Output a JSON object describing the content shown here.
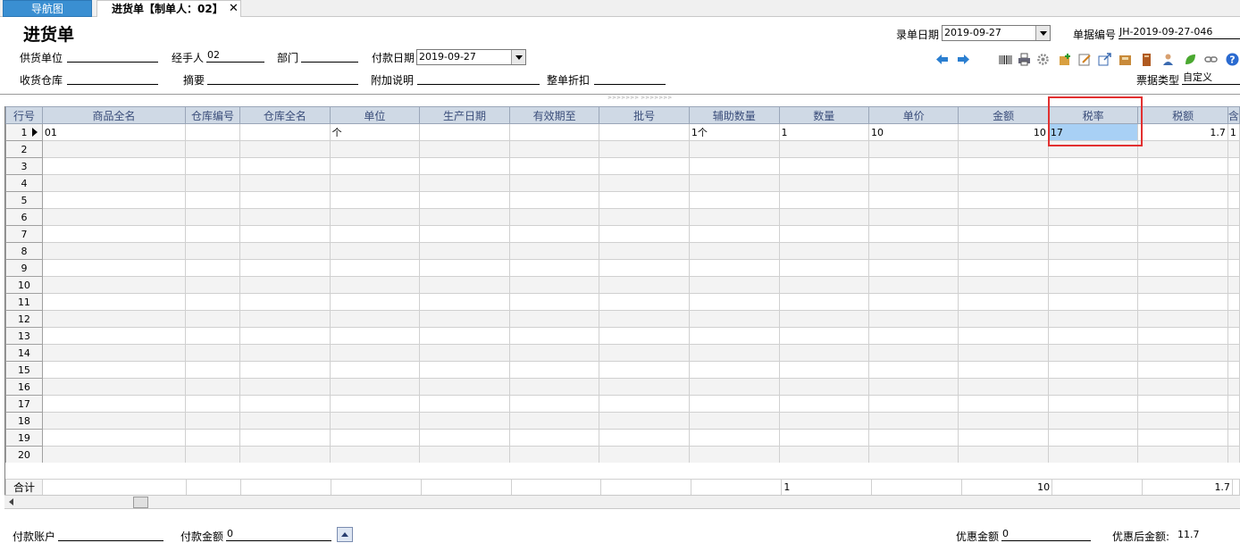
{
  "tabs": {
    "nav": "导航图",
    "purchase": "进货单【制单人：02】",
    "close": "✕"
  },
  "form": {
    "title": "进货单",
    "supplier_label": "供货单位",
    "supplier_value": "",
    "handler_label": "经手人",
    "handler_value": "02",
    "dept_label": "部门",
    "dept_value": "",
    "paydate_label": "付款日期",
    "paydate_value": "2019-09-27",
    "warehouse_label": "收货仓库",
    "warehouse_value": "",
    "summary_label": "摘要",
    "summary_value": "",
    "note_label": "附加说明",
    "note_value": "",
    "discount_label": "整单折扣",
    "discount_value": "",
    "entrydate_label": "录单日期",
    "entrydate_value": "2019-09-27",
    "docno_label": "单据编号",
    "docno_value": "JH-2019-09-27-046",
    "doctype_label": "票据类型",
    "doctype_value": "自定义"
  },
  "toolbar_icons": [
    "arrow-left-icon",
    "arrow-right-icon",
    "barcode-icon",
    "printer-icon",
    "gear-icon",
    "add-item-icon",
    "edit-icon",
    "export-icon",
    "folder-icon",
    "book-icon",
    "user-icon",
    "leaf-icon",
    "link-icon",
    "help-icon"
  ],
  "grid": {
    "headers": [
      "行号",
      "商品全名",
      "仓库编号",
      "仓库全名",
      "单位",
      "生产日期",
      "有效期至",
      "批号",
      "辅助数量",
      "数量",
      "单价",
      "金额",
      "税率",
      "税额",
      "含"
    ],
    "rows": [
      [
        "1",
        "01",
        "",
        "",
        "个",
        "",
        "",
        "",
        "1个",
        "1",
        "10",
        "10",
        "17",
        "1.7",
        "1"
      ],
      [
        "2",
        "",
        "",
        "",
        "",
        "",
        "",
        "",
        "",
        "",
        "",
        "",
        "",
        "",
        ""
      ],
      [
        "3",
        "",
        "",
        "",
        "",
        "",
        "",
        "",
        "",
        "",
        "",
        "",
        "",
        "",
        ""
      ],
      [
        "4",
        "",
        "",
        "",
        "",
        "",
        "",
        "",
        "",
        "",
        "",
        "",
        "",
        "",
        ""
      ],
      [
        "5",
        "",
        "",
        "",
        "",
        "",
        "",
        "",
        "",
        "",
        "",
        "",
        "",
        "",
        ""
      ],
      [
        "6",
        "",
        "",
        "",
        "",
        "",
        "",
        "",
        "",
        "",
        "",
        "",
        "",
        "",
        ""
      ],
      [
        "7",
        "",
        "",
        "",
        "",
        "",
        "",
        "",
        "",
        "",
        "",
        "",
        "",
        "",
        ""
      ],
      [
        "8",
        "",
        "",
        "",
        "",
        "",
        "",
        "",
        "",
        "",
        "",
        "",
        "",
        "",
        ""
      ],
      [
        "9",
        "",
        "",
        "",
        "",
        "",
        "",
        "",
        "",
        "",
        "",
        "",
        "",
        "",
        ""
      ],
      [
        "10",
        "",
        "",
        "",
        "",
        "",
        "",
        "",
        "",
        "",
        "",
        "",
        "",
        "",
        ""
      ],
      [
        "11",
        "",
        "",
        "",
        "",
        "",
        "",
        "",
        "",
        "",
        "",
        "",
        "",
        "",
        ""
      ],
      [
        "12",
        "",
        "",
        "",
        "",
        "",
        "",
        "",
        "",
        "",
        "",
        "",
        "",
        "",
        ""
      ],
      [
        "13",
        "",
        "",
        "",
        "",
        "",
        "",
        "",
        "",
        "",
        "",
        "",
        "",
        "",
        ""
      ],
      [
        "14",
        "",
        "",
        "",
        "",
        "",
        "",
        "",
        "",
        "",
        "",
        "",
        "",
        "",
        ""
      ],
      [
        "15",
        "",
        "",
        "",
        "",
        "",
        "",
        "",
        "",
        "",
        "",
        "",
        "",
        "",
        ""
      ],
      [
        "16",
        "",
        "",
        "",
        "",
        "",
        "",
        "",
        "",
        "",
        "",
        "",
        "",
        "",
        ""
      ],
      [
        "17",
        "",
        "",
        "",
        "",
        "",
        "",
        "",
        "",
        "",
        "",
        "",
        "",
        "",
        ""
      ],
      [
        "18",
        "",
        "",
        "",
        "",
        "",
        "",
        "",
        "",
        "",
        "",
        "",
        "",
        "",
        ""
      ],
      [
        "19",
        "",
        "",
        "",
        "",
        "",
        "",
        "",
        "",
        "",
        "",
        "",
        "",
        "",
        ""
      ],
      [
        "20",
        "",
        "",
        "",
        "",
        "",
        "",
        "",
        "",
        "",
        "",
        "",
        "",
        "",
        ""
      ]
    ],
    "sum": [
      "合计",
      "",
      "",
      "",
      "",
      "",
      "",
      "",
      "",
      "1",
      "",
      "10",
      "",
      "1.7",
      ""
    ]
  },
  "footer": {
    "account_label": "付款账户",
    "account_value": "",
    "payamount_label": "付款金额",
    "payamount_value": "0",
    "discount_amount_label": "优惠金额",
    "discount_amount_value": "0",
    "after_discount_label": "优惠后金额:",
    "after_discount_value": "11.7"
  },
  "colors": {
    "tab_active": "#3a8fd2",
    "grid_header": "#cfd9e5",
    "selected_cell": "#a8d0f5",
    "highlight_box": "#e23030"
  }
}
